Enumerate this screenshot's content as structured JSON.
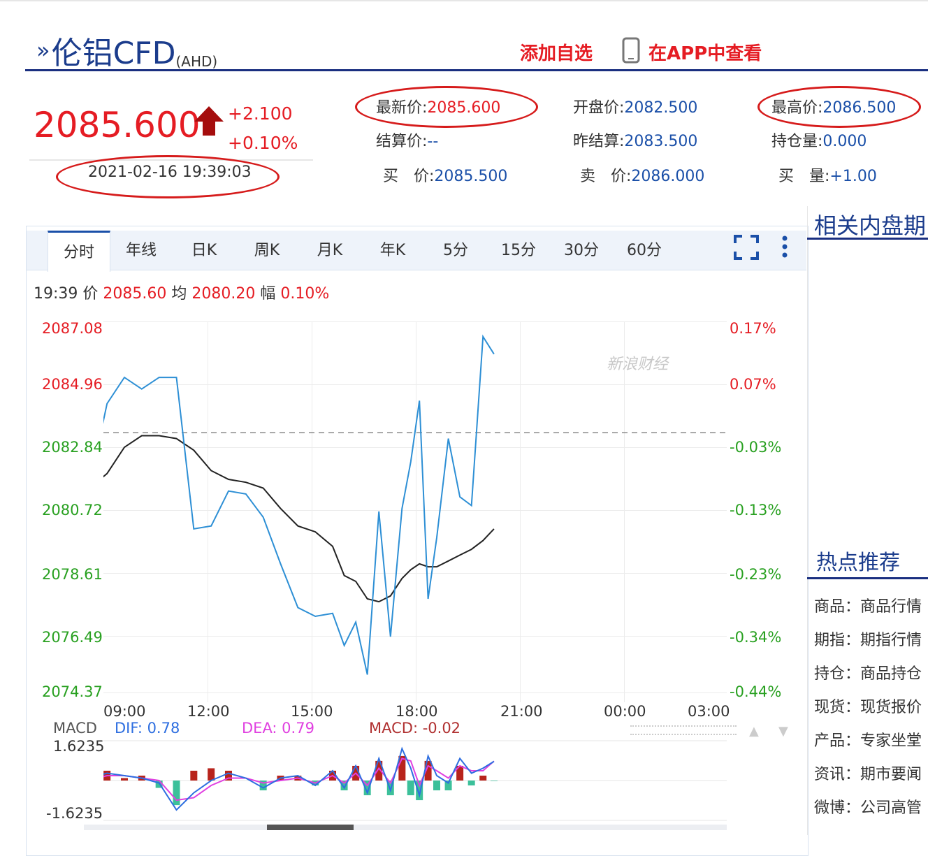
{
  "header": {
    "title": "伦铝CFD",
    "code": "(AHD)",
    "add_watch": "添加自选",
    "view_app": "在APP中查看"
  },
  "quote": {
    "price": "2085.600",
    "change": "+2.100",
    "change_pct": "+0.10%",
    "datetime": "2021-02-16 19:39:03",
    "fields": {
      "latest_label": "最新价:",
      "latest_value": "2085.600",
      "settle_label": "结算价:",
      "settle_value": "--",
      "bid_label": "买　价:",
      "bid_value": "2085.500",
      "open_label": "开盘价:",
      "open_value": "2082.500",
      "prev_settle_label": "昨结算:",
      "prev_settle_value": "2083.500",
      "ask_label": "卖　价:",
      "ask_value": "2086.000",
      "high_label": "最高价:",
      "high_value": "2086.500",
      "oi_label": "持仓量:",
      "oi_value": "0.000",
      "bid_vol_label": "买　量:",
      "bid_vol_value": "+1.00"
    }
  },
  "tabs": [
    "分时",
    "年线",
    "日K",
    "周K",
    "月K",
    "年K",
    "5分",
    "15分",
    "30分",
    "60分"
  ],
  "active_tab": "分时",
  "info": {
    "time": "19:39",
    "price_label": "价",
    "price": "2085.60",
    "avg_label": "均",
    "avg": "2080.20",
    "amp_label": "幅",
    "amp": "0.10%"
  },
  "watermark": "新浪财经",
  "macd": {
    "label": "MACD",
    "dif": "DIF: 0.78",
    "dea": "DEA: 0.79",
    "macd": "MACD: -0.02",
    "top": "1.6235",
    "bottom": "-1.6235"
  },
  "right_panel": {
    "title": "相关内盘期",
    "hot_title": "热点推荐",
    "items": [
      "商品：商品行情",
      "期指：期指行情",
      "持仓：商品持仓",
      "现货：现货报价",
      "产品：专家坐堂",
      "资讯：期市要闻",
      "微博：公司高管"
    ]
  },
  "chart_data": {
    "type": "line",
    "title": "",
    "x_ticks": [
      "09:00",
      "12:00",
      "15:00",
      "18:00",
      "21:00",
      "00:00",
      "03:00"
    ],
    "y_ticks_left": [
      "2087.08",
      "2084.96",
      "2082.84",
      "2080.72",
      "2078.61",
      "2076.49",
      "2074.37"
    ],
    "y_ticks_right": [
      "0.17%",
      "0.07%",
      "-0.03%",
      "-0.13%",
      "-0.23%",
      "-0.34%",
      "-0.44%"
    ],
    "ylim": [
      2074.37,
      2087.08
    ],
    "reference": 2083.5,
    "series": [
      {
        "x": [
          "08:00",
          "08:30",
          "09:00",
          "09:30",
          "10:00",
          "10:30",
          "11:00",
          "11:30",
          "12:00",
          "12:30",
          "13:00",
          "13:30",
          "14:00",
          "14:30",
          "15:00",
          "15:20",
          "15:40",
          "16:00",
          "16:20",
          "16:40",
          "17:00",
          "17:15",
          "17:30",
          "17:45",
          "18:00",
          "18:20",
          "18:40",
          "19:00",
          "19:20",
          "19:39"
        ],
        "values": [
          2081.7,
          2084.5,
          2085.4,
          2085.0,
          2085.4,
          2085.4,
          2080.2,
          2080.3,
          2081.5,
          2081.4,
          2080.6,
          2079.0,
          2077.5,
          2077.2,
          2077.3,
          2076.2,
          2077.0,
          2075.2,
          2080.8,
          2076.5,
          2080.9,
          2082.5,
          2084.6,
          2077.8,
          2079.9,
          2083.3,
          2081.3,
          2081.0,
          2086.8,
          2086.2
        ]
      },
      {
        "x": [
          "08:00",
          "08:30",
          "09:00",
          "09:30",
          "10:00",
          "10:30",
          "11:00",
          "11:30",
          "12:00",
          "12:30",
          "13:00",
          "13:30",
          "14:00",
          "14:30",
          "15:00",
          "15:20",
          "15:40",
          "16:00",
          "16:20",
          "16:40",
          "17:00",
          "17:15",
          "17:30",
          "17:45",
          "18:00",
          "18:20",
          "18:40",
          "19:00",
          "19:20",
          "19:39"
        ],
        "values": [
          2081.6,
          2082.1,
          2083.0,
          2083.4,
          2083.4,
          2083.3,
          2082.9,
          2082.2,
          2081.9,
          2081.8,
          2081.6,
          2080.9,
          2080.3,
          2080.1,
          2079.6,
          2078.6,
          2078.4,
          2077.8,
          2077.7,
          2077.9,
          2078.5,
          2078.8,
          2079.0,
          2078.9,
          2078.9,
          2079.1,
          2079.3,
          2079.5,
          2079.8,
          2080.2
        ]
      }
    ],
    "macd_series": {
      "ylim": [
        -1.6235,
        1.6235
      ],
      "dif": [
        0.1,
        0.3,
        0.2,
        0.1,
        -0.1,
        -1.2,
        -0.5,
        0.0,
        0.3,
        0.1,
        -0.3,
        0.1,
        0.2,
        -0.2,
        0.4,
        -0.3,
        0.6,
        -0.5,
        0.9,
        -0.4,
        1.3,
        0.5,
        -0.6,
        1.0,
        0.2,
        -0.1,
        0.9,
        0.3,
        0.5,
        0.78
      ],
      "dea": [
        0.0,
        0.2,
        0.2,
        0.1,
        0.0,
        -0.8,
        -0.7,
        -0.2,
        0.1,
        0.1,
        -0.1,
        0.0,
        0.1,
        -0.1,
        0.2,
        -0.1,
        0.3,
        -0.2,
        0.5,
        -0.1,
        0.9,
        0.8,
        -0.2,
        0.6,
        0.4,
        0.1,
        0.6,
        0.4,
        0.4,
        0.79
      ],
      "macd": [
        0.2,
        0.4,
        0.1,
        0.2,
        -0.3,
        -1.0,
        0.4,
        0.5,
        0.4,
        0.0,
        -0.4,
        0.2,
        0.2,
        -0.2,
        0.4,
        -0.4,
        0.6,
        -0.6,
        0.8,
        -0.6,
        1.0,
        -0.6,
        -0.8,
        0.8,
        -0.4,
        -0.4,
        0.6,
        -0.2,
        0.2,
        -0.02
      ]
    }
  }
}
